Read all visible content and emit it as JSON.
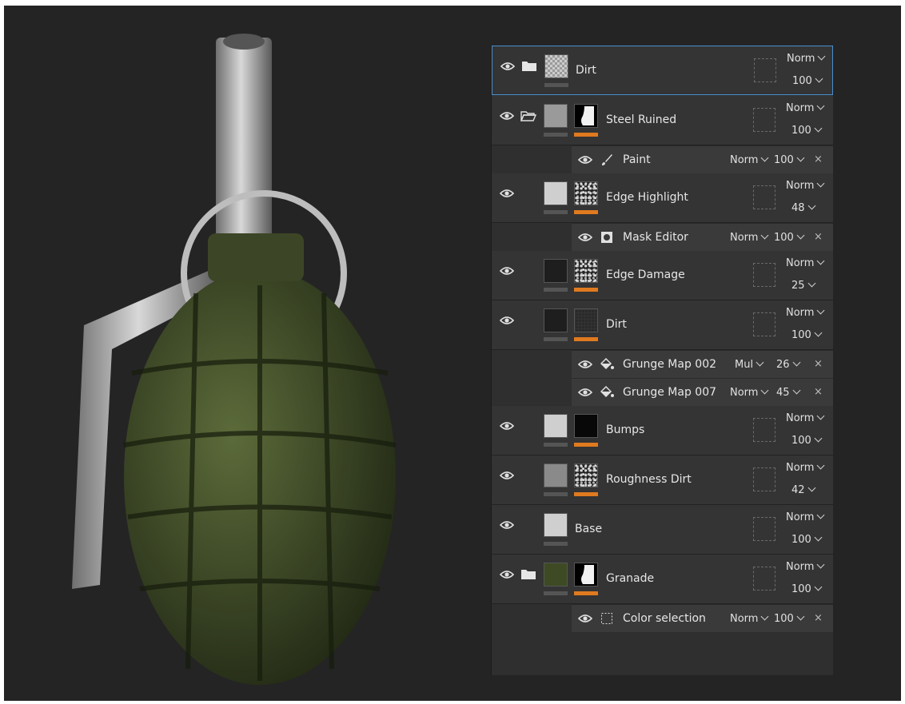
{
  "layers": [
    {
      "name": "Dirt",
      "blend": "Norm",
      "opacity": "100"
    },
    {
      "name": "Steel Ruined",
      "blend": "Norm",
      "opacity": "100",
      "effects": [
        {
          "name": "Paint",
          "blend": "Norm",
          "opacity": "100"
        }
      ]
    },
    {
      "name": "Edge Highlight",
      "blend": "Norm",
      "opacity": "48",
      "effects": [
        {
          "name": "Mask Editor",
          "blend": "Norm",
          "opacity": "100"
        }
      ]
    },
    {
      "name": "Edge Damage",
      "blend": "Norm",
      "opacity": "25"
    },
    {
      "name": "Dirt",
      "blend": "Norm",
      "opacity": "100",
      "effects": [
        {
          "name": "Grunge Map 002",
          "blend": "Mul",
          "opacity": "26"
        },
        {
          "name": "Grunge Map 007",
          "blend": "Norm",
          "opacity": "45"
        }
      ]
    },
    {
      "name": "Bumps",
      "blend": "Norm",
      "opacity": "100"
    },
    {
      "name": "Roughness Dirt",
      "blend": "Norm",
      "opacity": "42"
    },
    {
      "name": "Base",
      "blend": "Norm",
      "opacity": "100"
    },
    {
      "name": "Granade",
      "blend": "Norm",
      "opacity": "100",
      "effects": [
        {
          "name": "Color selection",
          "blend": "Norm",
          "opacity": "100"
        }
      ]
    }
  ],
  "colors": {
    "accent_orange": "#e07a1f",
    "selection": "#4a8fcf"
  },
  "close_glyph": "×"
}
